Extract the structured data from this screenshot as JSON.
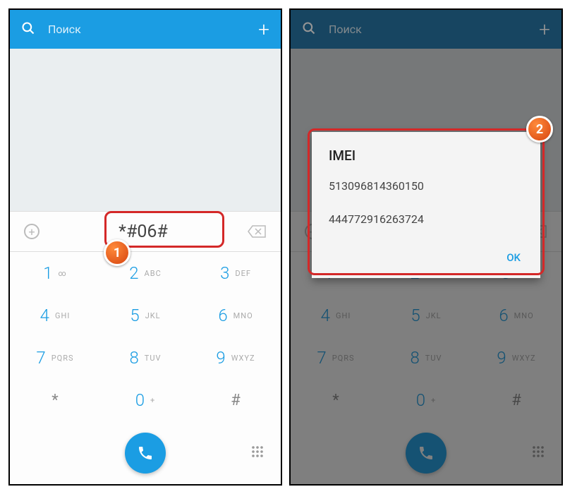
{
  "search": {
    "placeholder": "Поиск"
  },
  "input": {
    "value": "*#06#"
  },
  "keys": {
    "k1": {
      "digit": "1",
      "letters": "∞"
    },
    "k2": {
      "digit": "2",
      "letters": "ABC"
    },
    "k3": {
      "digit": "3",
      "letters": "DEF"
    },
    "k4": {
      "digit": "4",
      "letters": "GHI"
    },
    "k5": {
      "digit": "5",
      "letters": "JKL"
    },
    "k6": {
      "digit": "6",
      "letters": "MNO"
    },
    "k7": {
      "digit": "7",
      "letters": "PQRS"
    },
    "k8": {
      "digit": "8",
      "letters": "TUV"
    },
    "k9": {
      "digit": "9",
      "letters": "WXYZ"
    },
    "kstar": {
      "symbol": "*"
    },
    "k0": {
      "digit": "0",
      "letters": "+"
    },
    "khash": {
      "symbol": "#"
    }
  },
  "badge1": "1",
  "badge2": "2",
  "dialog": {
    "title": "IMEI",
    "imei1": "513096814360150",
    "imei2": "444772916263724",
    "ok": "OK"
  }
}
